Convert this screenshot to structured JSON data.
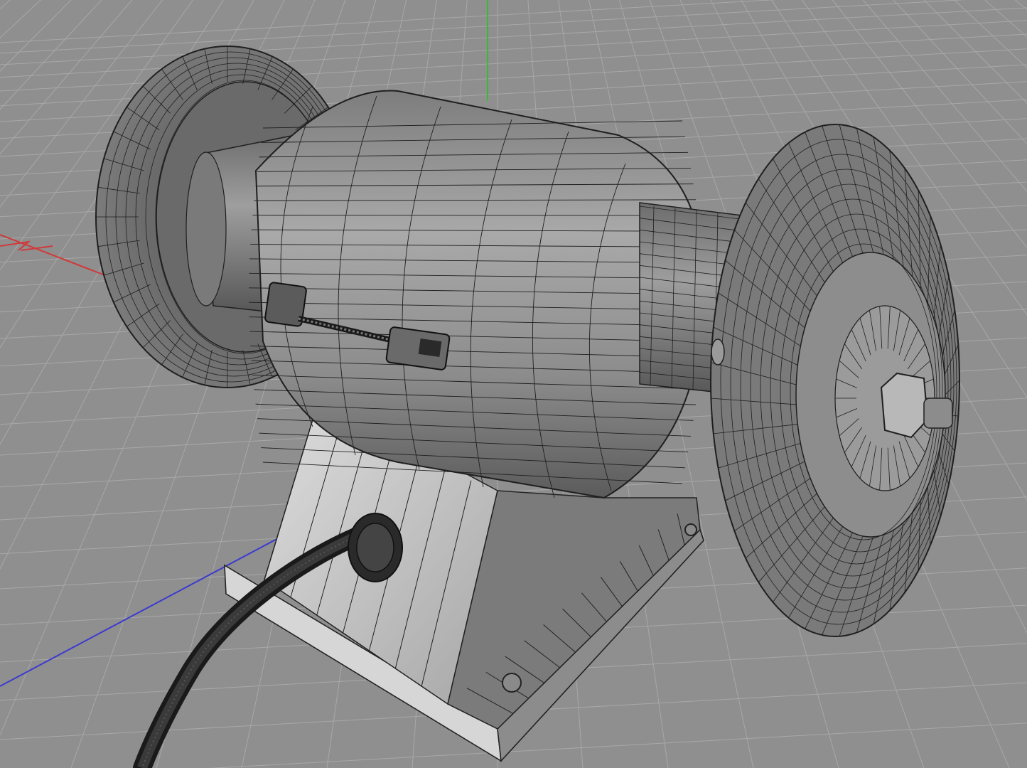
{
  "viewport": {
    "name": "perspective-viewport",
    "background": "#8f8f8f",
    "grid_color": "#a6a6a6",
    "axis_colors": {
      "x": "#d03a3a",
      "y": "#2fbf2f",
      "z": "#3b3bcf"
    }
  },
  "model": {
    "object": "bench-grinder",
    "display_mode": "wireframe-on-shaded",
    "shade_light": "#c9c9c9",
    "shade_mid": "#8a8a8a",
    "shade_dark": "#4f4f4f",
    "wire_color": "#1f1f1f"
  }
}
